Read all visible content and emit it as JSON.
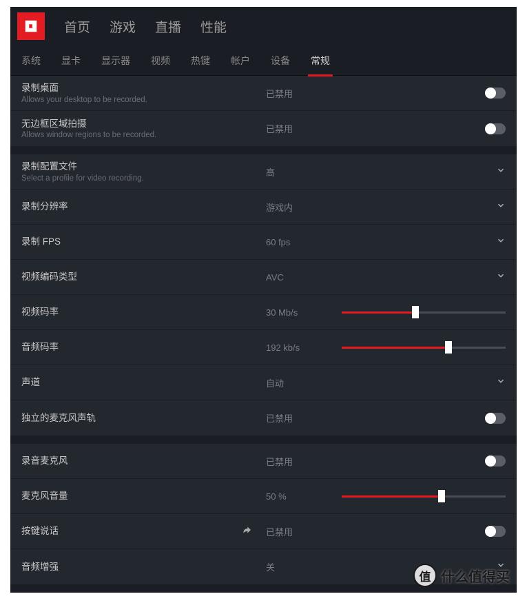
{
  "main_nav": {
    "home": "首页",
    "games": "游戏",
    "streaming": "直播",
    "performance": "性能"
  },
  "sub_nav": {
    "system": "系统",
    "graphics": "显卡",
    "display": "显示器",
    "video": "视频",
    "hotkeys": "热键",
    "account": "帐户",
    "device": "设备",
    "general": "常规"
  },
  "settings": {
    "record_desktop": {
      "label": "录制桌面",
      "desc": "Allows your desktop to be recorded.",
      "value": "已禁用"
    },
    "borderless_region": {
      "label": "无边框区域拍摄",
      "desc": "Allows window regions to be recorded.",
      "value": "已禁用"
    },
    "recording_profile": {
      "label": "录制配置文件",
      "desc": "Select a profile for video recording.",
      "value": "高"
    },
    "recording_resolution": {
      "label": "录制分辨率",
      "value": "游戏内"
    },
    "recording_fps": {
      "label": "录制 FPS",
      "value": "60 fps"
    },
    "video_encoding": {
      "label": "视频编码类型",
      "value": "AVC"
    },
    "video_bitrate": {
      "label": "视频码率",
      "value": "30 Mb/s",
      "slider_pct": 45
    },
    "audio_bitrate": {
      "label": "音频码率",
      "value": "192 kb/s",
      "slider_pct": 65
    },
    "channels": {
      "label": "声道",
      "value": "自动"
    },
    "separate_mic_track": {
      "label": "独立的麦克风声轨",
      "value": "已禁用"
    },
    "record_microphone": {
      "label": "录音麦克风",
      "value": "已禁用"
    },
    "mic_volume": {
      "label": "麦克风音量",
      "value": "50 %",
      "slider_pct": 61
    },
    "push_to_talk": {
      "label": "按键说话",
      "value": "已禁用"
    },
    "audio_boost": {
      "label": "音频增强",
      "value": "关"
    }
  },
  "watermark": {
    "badge": "值",
    "text": "什么值得买"
  }
}
